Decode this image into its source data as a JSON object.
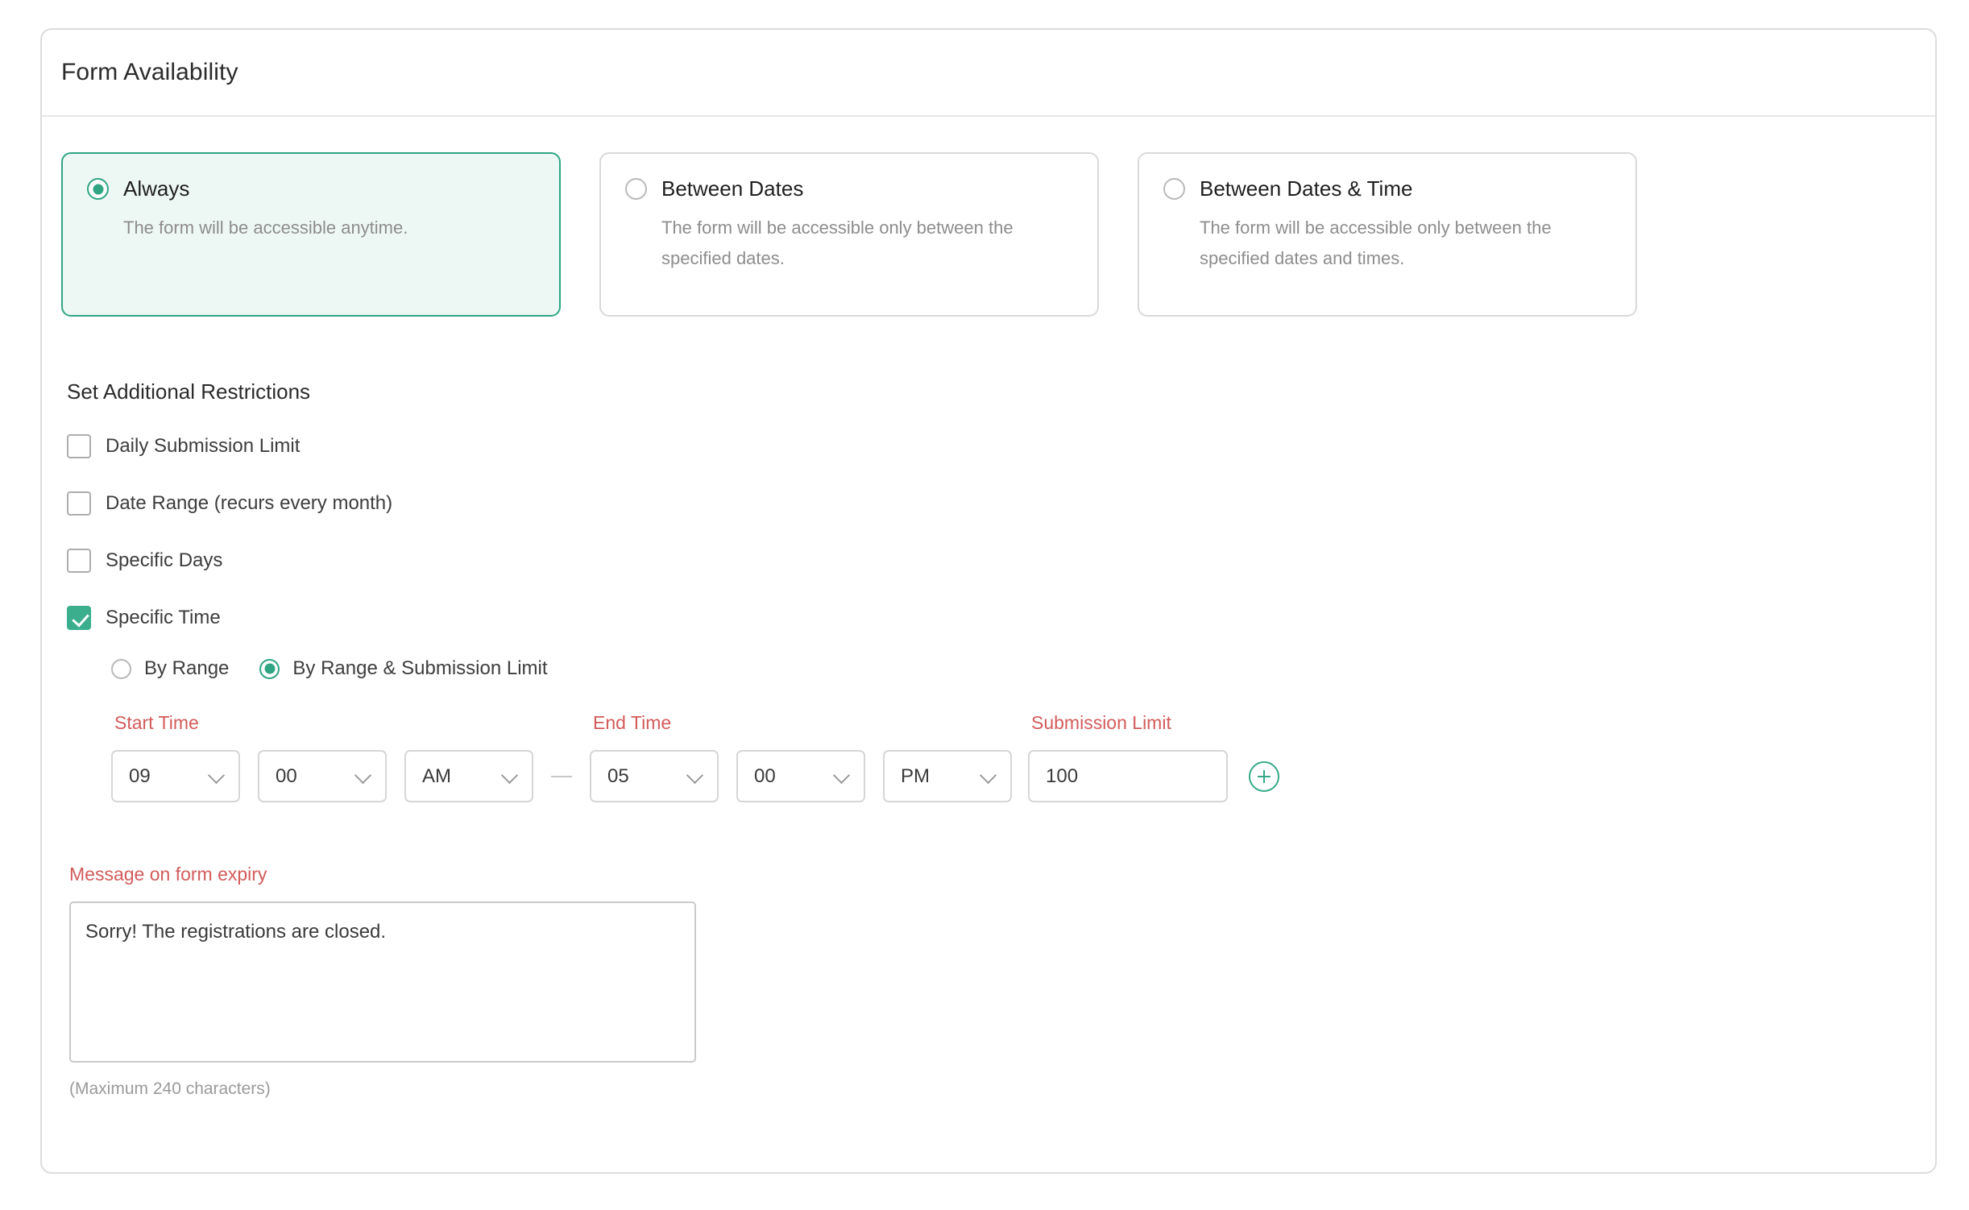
{
  "panel": {
    "title": "Form Availability"
  },
  "availability": {
    "options": [
      {
        "id": "always",
        "label": "Always",
        "description": "The form will be accessible anytime.",
        "selected": true
      },
      {
        "id": "between-dates",
        "label": "Between Dates",
        "description": "The form will be accessible only between the specified dates.",
        "selected": false
      },
      {
        "id": "between-dates-time",
        "label": "Between Dates & Time",
        "description": "The form will be accessible only between the specified dates and times.",
        "selected": false
      }
    ]
  },
  "restrictions": {
    "title": "Set Additional Restrictions",
    "items": [
      {
        "id": "daily-submission-limit",
        "label": "Daily Submission Limit",
        "checked": false
      },
      {
        "id": "date-range",
        "label": "Date Range (recurs every month)",
        "checked": false
      },
      {
        "id": "specific-days",
        "label": "Specific Days",
        "checked": false
      },
      {
        "id": "specific-time",
        "label": "Specific Time",
        "checked": true
      }
    ]
  },
  "specific_time": {
    "modes": [
      {
        "id": "by-range",
        "label": "By Range",
        "selected": false
      },
      {
        "id": "by-range-submission-limit",
        "label": "By Range & Submission Limit",
        "selected": true
      }
    ],
    "start_time": {
      "label": "Start Time",
      "hour": "09",
      "minute": "00",
      "meridiem": "AM"
    },
    "separator": "—",
    "end_time": {
      "label": "End Time",
      "hour": "05",
      "minute": "00",
      "meridiem": "PM"
    },
    "submission_limit": {
      "label": "Submission Limit",
      "value": "100",
      "placeholder": ""
    },
    "add_button_icon": "plus-circle-icon"
  },
  "expiry": {
    "label": "Message on form expiry",
    "value": "Sorry! The registrations are closed.",
    "placeholder": "",
    "hint": "(Maximum 240 characters)"
  },
  "colors": {
    "accent": "#2fa583",
    "accent_fill": "#3aae8d",
    "selected_card_bg": "#edf8f4",
    "label_red": "#d35b5b",
    "border": "#d9d9d9"
  }
}
